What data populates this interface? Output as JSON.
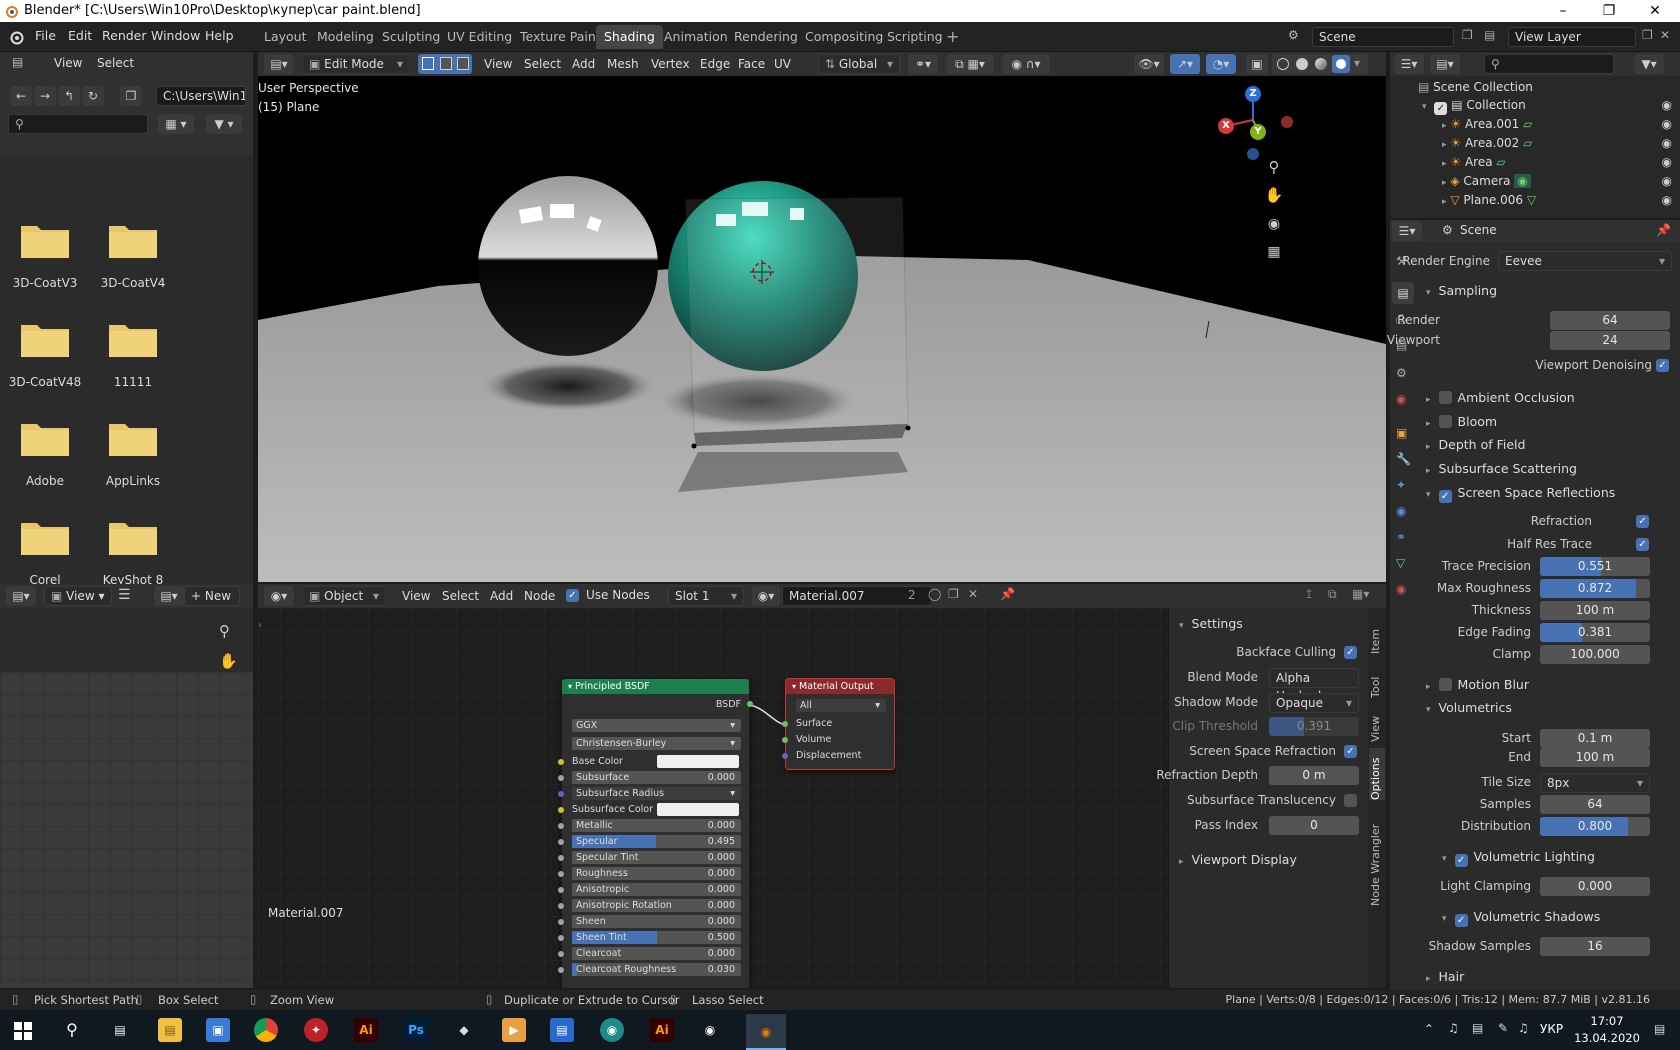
{
  "window": {
    "title": "Blender* [C:\\Users\\Win10Pro\\Desktop\\купер\\car paint.blend]"
  },
  "topbar": {
    "menus": [
      "File",
      "Edit",
      "Render",
      "Window",
      "Help"
    ],
    "workspaces": [
      "Layout",
      "Modeling",
      "Sculpting",
      "UV Editing",
      "Texture Paint",
      "Shading",
      "Animation",
      "Rendering",
      "Compositing",
      "Scripting"
    ],
    "active_workspace": "Shading",
    "scene": "Scene",
    "view_layer": "View Layer"
  },
  "filebrowser": {
    "menus": [
      "View",
      "Select"
    ],
    "path": "C:\\Users\\Win1...",
    "folders": [
      "3D-CoatV3",
      "3D-CoatV4",
      "3D-CoatV48",
      "11111",
      "Adobe",
      "AppLinks",
      "Corel",
      "KeyShot 8"
    ]
  },
  "viewport": {
    "mode": "Edit Mode",
    "menus": [
      "View",
      "Select",
      "Add",
      "Mesh",
      "Vertex",
      "Edge",
      "Face",
      "UV"
    ],
    "orientation": "Global",
    "overlay_title": "User Perspective",
    "overlay_object": "(15) Plane",
    "gizmo": {
      "x": "X",
      "y": "Y",
      "z": "Z"
    }
  },
  "imageeditor": {
    "view": "View",
    "new": "New"
  },
  "nodeeditor": {
    "mode": "Object",
    "menus": [
      "View",
      "Select",
      "Add",
      "Node"
    ],
    "use_nodes": "Use Nodes",
    "slot": "Slot 1",
    "material": "Material.007",
    "users": "2",
    "footer_label": "Material.007"
  },
  "principled": {
    "title": "Principled BSDF",
    "output": "BSDF",
    "distribution": "GGX",
    "subsurface_method": "Christensen-Burley",
    "base_color": "Base Color",
    "subsurface_radius": "Subsurface Radius",
    "subsurface_color": "Subsurface Color",
    "fields": [
      {
        "label": "Subsurface",
        "value": "0.000",
        "fill": 0
      },
      {
        "label": "Metallic",
        "value": "0.000",
        "fill": 0
      },
      {
        "label": "Specular",
        "value": "0.495",
        "fill": 0.495
      },
      {
        "label": "Specular Tint",
        "value": "0.000",
        "fill": 0
      },
      {
        "label": "Roughness",
        "value": "0.000",
        "fill": 0
      },
      {
        "label": "Anisotropic",
        "value": "0.000",
        "fill": 0
      },
      {
        "label": "Anisotropic Rotation",
        "value": "0.000",
        "fill": 0
      },
      {
        "label": "Sheen",
        "value": "0.000",
        "fill": 0
      },
      {
        "label": "Sheen Tint",
        "value": "0.500",
        "fill": 0.5
      },
      {
        "label": "Clearcoat",
        "value": "0.000",
        "fill": 0
      },
      {
        "label": "Clearcoat Roughness",
        "value": "0.030",
        "fill": 0.03
      }
    ]
  },
  "matoutput": {
    "title": "Material Output",
    "target": "All",
    "inputs": [
      "Surface",
      "Volume",
      "Displacement"
    ]
  },
  "npanel": {
    "tabs": [
      "Item",
      "Tool",
      "View",
      "Options",
      "Node Wrangler"
    ],
    "settings_title": "Settings",
    "backface_culling": "Backface Culling",
    "blend_mode_label": "Blend Mode",
    "blend_mode": "Alpha Hashed",
    "shadow_mode_label": "Shadow Mode",
    "shadow_mode": "Opaque",
    "clip_threshold_label": "Clip Threshold",
    "clip_threshold": "0.391",
    "clip_threshold_fill": 0.391,
    "ssr_label": "Screen Space Refraction",
    "refraction_depth_label": "Refraction Depth",
    "refraction_depth": "0 m",
    "subsurface_translucency": "Subsurface Translucency",
    "pass_index_label": "Pass Index",
    "pass_index": "0",
    "viewport_display": "Viewport Display"
  },
  "outliner": {
    "root": "Scene Collection",
    "collection": "Collection",
    "items": [
      "Area.001",
      "Area.002",
      "Area",
      "Camera",
      "Plane.006"
    ]
  },
  "properties": {
    "context": "Scene",
    "render_engine_label": "Render Engine",
    "render_engine": "Eevee",
    "sampling": "Sampling",
    "render_label": "Render",
    "render_samples": "64",
    "viewport_label": "Viewport",
    "viewport_samples": "24",
    "viewport_denoising": "Viewport Denoising",
    "ambient_occlusion": "Ambient Occlusion",
    "bloom": "Bloom",
    "depth_of_field": "Depth of Field",
    "subsurface_scattering": "Subsurface Scattering",
    "ssr": "Screen Space Reflections",
    "refraction": "Refraction",
    "half_res_trace": "Half Res Trace",
    "trace_precision_label": "Trace Precision",
    "trace_precision": "0.551",
    "trace_precision_fill": 0.551,
    "max_roughness_label": "Max Roughness",
    "max_roughness": "0.872",
    "max_roughness_fill": 0.872,
    "thickness_label": "Thickness",
    "thickness": "100 m",
    "edge_fading_label": "Edge Fading",
    "edge_fading": "0.381",
    "edge_fading_fill": 0.381,
    "clamp_label": "Clamp",
    "clamp": "100.000",
    "motion_blur": "Motion Blur",
    "volumetrics": "Volumetrics",
    "start_label": "Start",
    "start": "0.1 m",
    "end_label": "End",
    "end": "100 m",
    "tile_size_label": "Tile Size",
    "tile_size": "8px",
    "samples_label": "Samples",
    "samples": "64",
    "distribution_label": "Distribution",
    "distribution": "0.800",
    "distribution_fill": 0.8,
    "volumetric_lighting": "Volumetric Lighting",
    "light_clamping_label": "Light Clamping",
    "light_clamping": "0.000",
    "volumetric_shadows": "Volumetric Shadows",
    "shadow_samples_label": "Shadow Samples",
    "shadow_samples": "16",
    "hair": "Hair"
  },
  "status": {
    "pick_shortest_path": "Pick Shortest Path",
    "box_select": "Box Select",
    "zoom_view": "Zoom View",
    "duplicate": "Duplicate or Extrude to Cursor",
    "lasso": "Lasso Select",
    "stats": "Plane | Verts:0/8 | Edges:0/12 | Faces:0/6 | Tris:12 | Mem: 87.7 MiB | v2.81.16"
  },
  "taskbar": {
    "lang": "УКР",
    "time": "17:07",
    "date": "13.04.2020"
  },
  "colors": {
    "accent": "#4772b3",
    "node_shader": "#1d7f4e",
    "node_output": "#8a2a2a",
    "folder": "#e8c66a"
  }
}
